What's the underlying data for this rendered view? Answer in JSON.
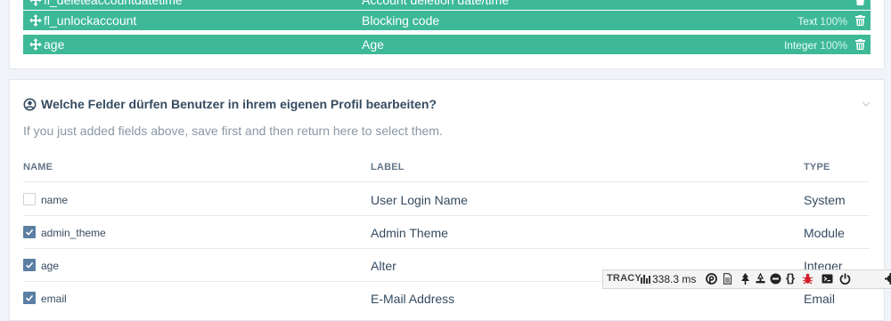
{
  "fields": [
    {
      "name": "fl_deleteaccountdatetime",
      "label": "Account deletion date/time",
      "type": "",
      "pct": ""
    },
    {
      "name": "fl_unlockaccount",
      "label": "Blocking code",
      "type": "Text",
      "pct": "100%"
    },
    {
      "name": "age",
      "label": "Age",
      "type": "Integer",
      "pct": "100%"
    }
  ],
  "section": {
    "title": "Welche Felder dürfen Benutzer in ihrem eigenen Profil bearbeiten?",
    "hint": "If you just added fields above, save first and then return here to select them."
  },
  "table": {
    "headers": {
      "name": "NAME",
      "label": "LABEL",
      "type": "TYPE"
    },
    "rows": [
      {
        "name": "name",
        "label": "User Login Name",
        "type": "System",
        "checked": false
      },
      {
        "name": "admin_theme",
        "label": "Admin Theme",
        "type": "Module",
        "checked": true
      },
      {
        "name": "age",
        "label": "Alter",
        "type": "Integer",
        "checked": true
      },
      {
        "name": "email",
        "label": "E-Mail Address",
        "type": "Email",
        "checked": true
      }
    ]
  },
  "tracy": {
    "brand": "TRACY",
    "time": "338.3 ms"
  },
  "colors": {
    "accent_green": "#3eb998",
    "checkbox": "#5b7fa3",
    "text": "#354b60"
  }
}
